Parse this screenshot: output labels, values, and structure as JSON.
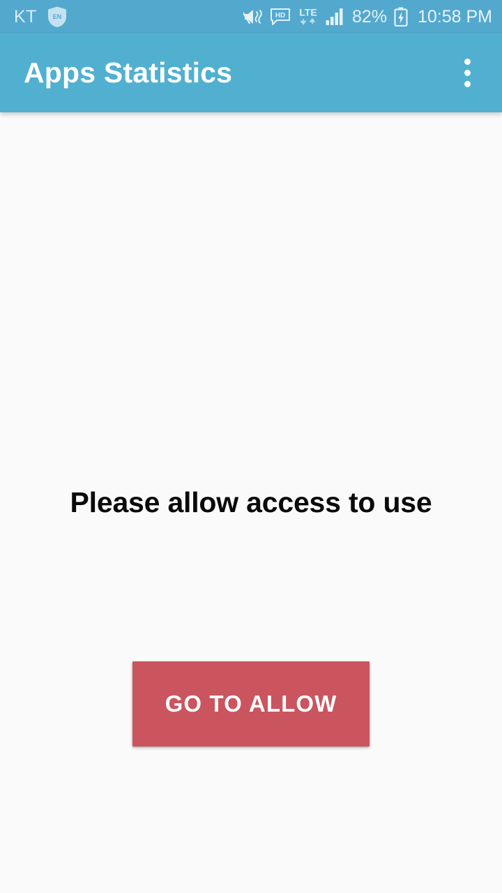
{
  "status_bar": {
    "carrier": "KT",
    "vpn_badge_label": "EN",
    "network_type": "LTE",
    "battery_percent": "82%",
    "clock": "10:58 PM",
    "icons": [
      "mute-vibrate-icon",
      "hd-voice-icon",
      "lte-data-icon",
      "signal-bars-icon",
      "battery-charging-icon"
    ],
    "background_color": "#53a8ce",
    "text_color": "#e3f1f9"
  },
  "app_bar": {
    "title": "Apps Statistics",
    "overflow_menu_label": "More options",
    "background_color": "#51b0cf",
    "title_color": "#ffffff"
  },
  "main": {
    "headline": "Please allow access to use",
    "primary_button_label": "GO TO ALLOW",
    "background_color": "#fafafa",
    "headline_color": "#0a0a0a",
    "button_color": "#ca555f",
    "button_text_color": "#ffffff"
  }
}
